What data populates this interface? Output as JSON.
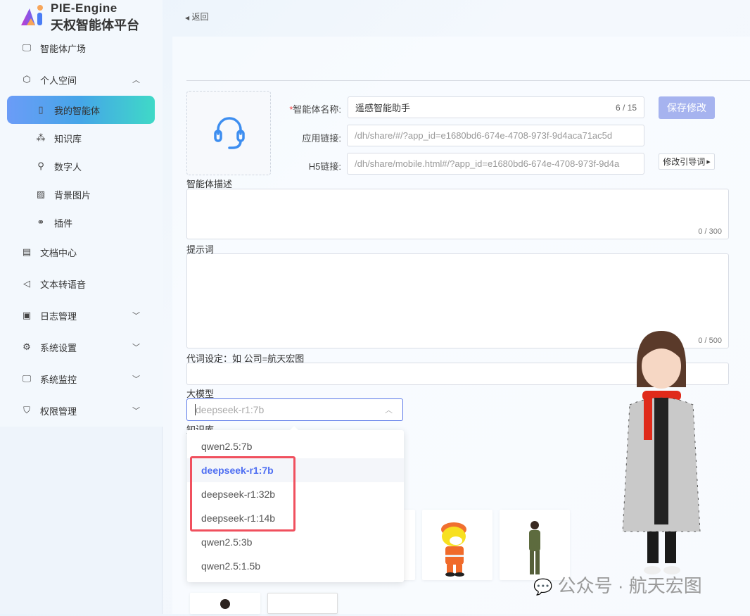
{
  "brand": {
    "line1": "PIE-Engine",
    "line2": "天权智能体平台"
  },
  "sidebar": {
    "items": [
      {
        "label": "智能体广场",
        "icon": "monitor-icon"
      },
      {
        "label": "个人空间",
        "icon": "cube-icon",
        "expanded": true
      },
      {
        "label": "我的智能体",
        "icon": "tablet-icon",
        "active": true
      },
      {
        "label": "知识库",
        "icon": "nodes-icon"
      },
      {
        "label": "数字人",
        "icon": "user-icon"
      },
      {
        "label": "背景图片",
        "icon": "image-icon"
      },
      {
        "label": "插件",
        "icon": "plug-icon"
      },
      {
        "label": "文档中心",
        "icon": "document-icon"
      },
      {
        "label": "文本转语音",
        "icon": "speaker-icon"
      },
      {
        "label": "日志管理",
        "icon": "log-icon"
      },
      {
        "label": "系统设置",
        "icon": "gear-icon"
      },
      {
        "label": "系统监控",
        "icon": "monitor-icon"
      },
      {
        "label": "权限管理",
        "icon": "shield-icon"
      }
    ]
  },
  "header": {
    "back": "返回"
  },
  "form": {
    "name_label": "智能体名称:",
    "name_required": "*",
    "name_value": "遥感智能助手",
    "name_count": "6 / 15",
    "app_link_label": "应用链接:",
    "app_link_value": "/dh/share/#/?app_id=e1680bd6-674e-4708-973f-9d4aca71ac5d",
    "h5_link_label": "H5链接:",
    "h5_link_value": "/dh/share/mobile.html#/?app_id=e1680bd6-674e-4708-973f-9d4a",
    "save_button": "保存修改",
    "guide_button": "修改引导词",
    "desc_label": "智能体描述",
    "desc_count": "0 / 300",
    "prompt_label": "提示词",
    "prompt_count": "0 / 500",
    "pronoun_label": "代词设定：如 公司=航天宏图",
    "model_label": "大模型",
    "model_value": "deepseek-r1:7b",
    "kb_label": "知识库"
  },
  "dropdown": {
    "options": [
      "qwen2.5:7b",
      "deepseek-r1:7b",
      "deepseek-r1:32b",
      "deepseek-r1:14b",
      "qwen2.5:3b",
      "qwen2.5:1.5b"
    ],
    "selected": "deepseek-r1:7b"
  },
  "watermark": "公众号 · 航天宏图"
}
